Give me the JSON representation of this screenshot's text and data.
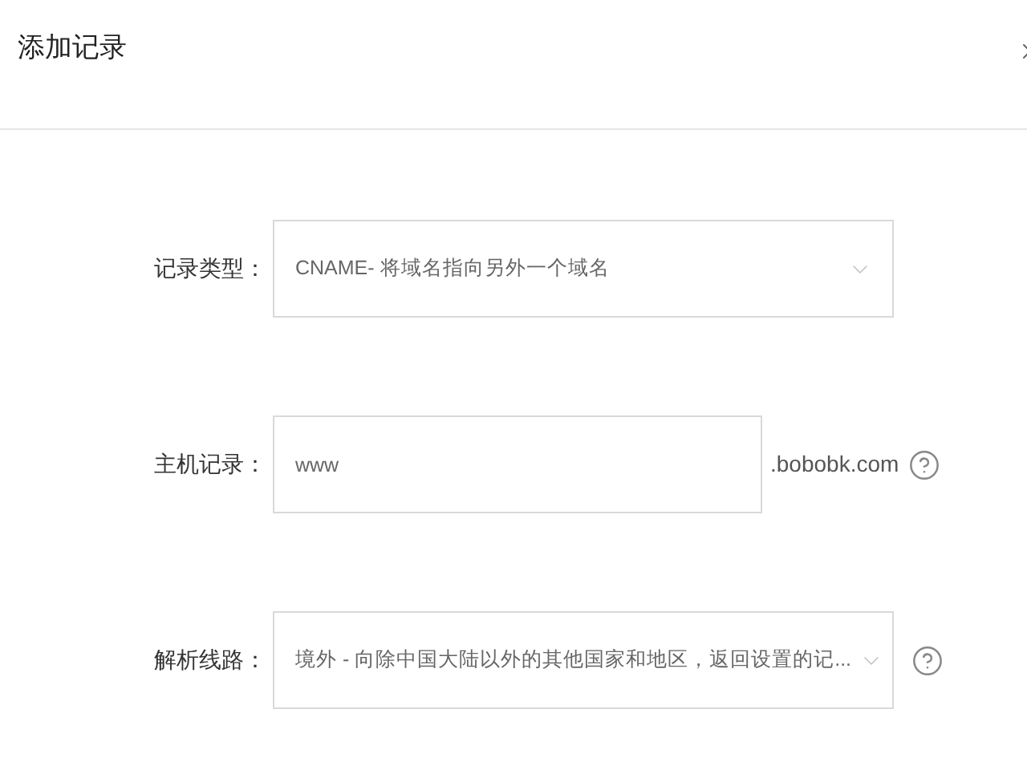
{
  "dialog": {
    "title": "添加记录"
  },
  "fields": [
    {
      "kind": "select",
      "label": "记录类型：",
      "value": "CNAME- 将域名指向另外一个域名",
      "help": false
    },
    {
      "kind": "input",
      "label": "主机记录：",
      "value": "www",
      "suffix": ".bobobk.com",
      "help": true
    },
    {
      "kind": "select",
      "label": "解析线路：",
      "value": "境外 - 向除中国大陆以外的其他国家和地区，返回设置的记...",
      "help": true
    }
  ]
}
